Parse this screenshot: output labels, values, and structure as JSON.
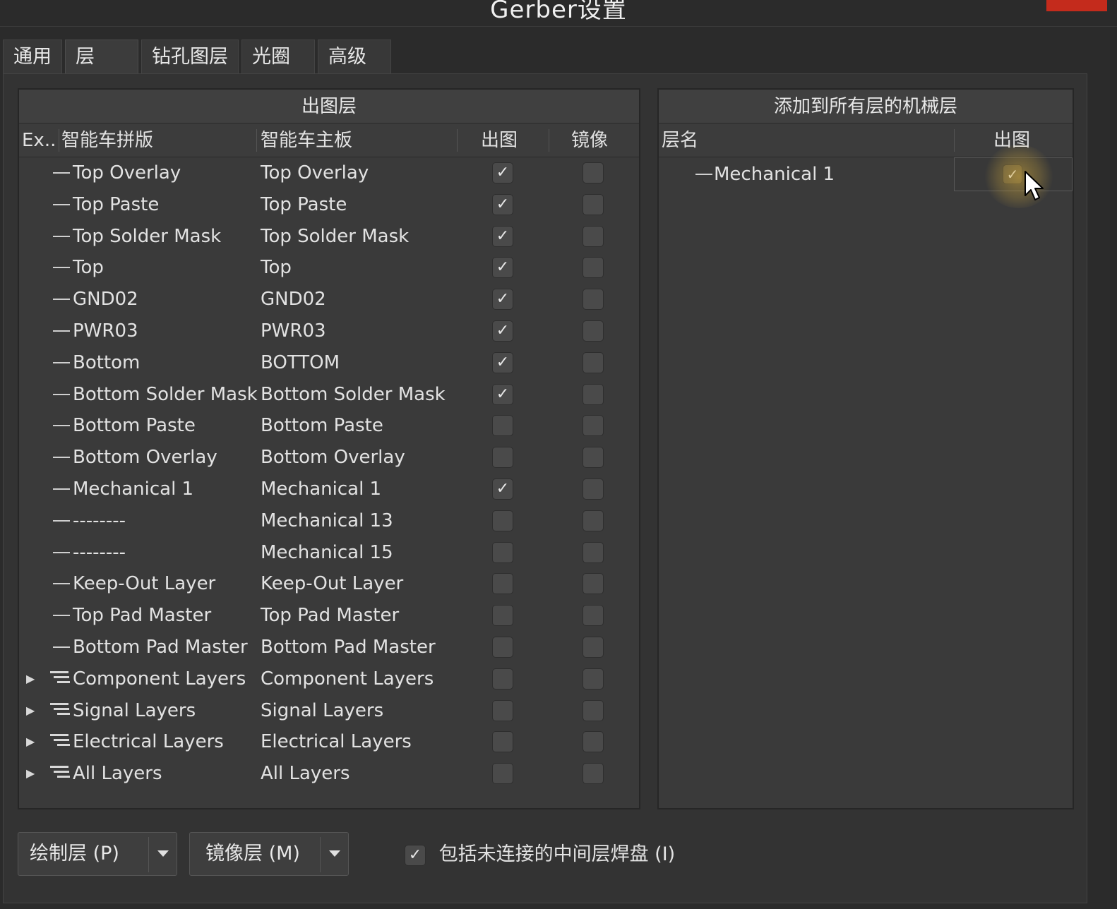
{
  "window": {
    "title": "Gerber设置"
  },
  "tabs": [
    "通用",
    "层",
    "钻孔图层",
    "光圈",
    "高级"
  ],
  "left_panel": {
    "title": "出图层",
    "columns": [
      "Ex...",
      "智能车拼版",
      "智能车主板",
      "出图",
      "镜像"
    ],
    "rows": [
      {
        "name1": "Top Overlay",
        "name2": "Top Overlay",
        "plot": true,
        "mirror": false
      },
      {
        "name1": "Top Paste",
        "name2": "Top Paste",
        "plot": true,
        "mirror": false
      },
      {
        "name1": "Top Solder Mask",
        "name2": "Top Solder Mask",
        "plot": true,
        "mirror": false
      },
      {
        "name1": "Top",
        "name2": "Top",
        "plot": true,
        "mirror": false
      },
      {
        "name1": "GND02",
        "name2": "GND02",
        "plot": true,
        "mirror": false
      },
      {
        "name1": " PWR03",
        "name2": "PWR03",
        "plot": true,
        "mirror": false
      },
      {
        "name1": "Bottom",
        "name2": "BOTTOM",
        "plot": true,
        "mirror": false
      },
      {
        "name1": "Bottom Solder Mask",
        "name2": "Bottom Solder Mask",
        "plot": true,
        "mirror": false
      },
      {
        "name1": "Bottom Paste",
        "name2": "Bottom Paste",
        "plot": false,
        "mirror": false
      },
      {
        "name1": "Bottom Overlay",
        "name2": "Bottom Overlay",
        "plot": false,
        "mirror": false
      },
      {
        "name1": "Mechanical 1",
        "name2": "Mechanical 1",
        "plot": true,
        "mirror": false
      },
      {
        "name1": "--------",
        "name2": "Mechanical 13",
        "plot": false,
        "mirror": false
      },
      {
        "name1": "--------",
        "name2": "Mechanical 15",
        "plot": false,
        "mirror": false
      },
      {
        "name1": "Keep-Out Layer",
        "name2": "Keep-Out Layer",
        "plot": false,
        "mirror": false
      },
      {
        "name1": "Top Pad Master",
        "name2": "Top Pad Master",
        "plot": false,
        "mirror": false
      },
      {
        "name1": "Bottom Pad Master",
        "name2": "Bottom Pad Master",
        "plot": false,
        "mirror": false
      },
      {
        "name1": "Component Layers",
        "name2": "Component Layers",
        "plot": false,
        "mirror": false,
        "group": true
      },
      {
        "name1": "Signal Layers",
        "name2": "Signal Layers",
        "plot": false,
        "mirror": false,
        "group": true
      },
      {
        "name1": "Electrical Layers",
        "name2": "Electrical Layers",
        "plot": false,
        "mirror": false,
        "group": true
      },
      {
        "name1": "All Layers",
        "name2": "All Layers",
        "plot": false,
        "mirror": false,
        "group": true
      }
    ]
  },
  "right_panel": {
    "title": "添加到所有层的机械层",
    "columns": [
      "层名",
      "出图"
    ],
    "rows": [
      {
        "name": "Mechanical 1",
        "plot": true
      }
    ]
  },
  "footer": {
    "plot_layers_button": "绘制层 (P)",
    "mirror_layers_button": "镜像层 (M)",
    "include_pads_label": "包括未连接的中间层焊盘 (I)",
    "include_pads_checked": true
  },
  "icons": {
    "check": "✓",
    "expand": "▶"
  }
}
